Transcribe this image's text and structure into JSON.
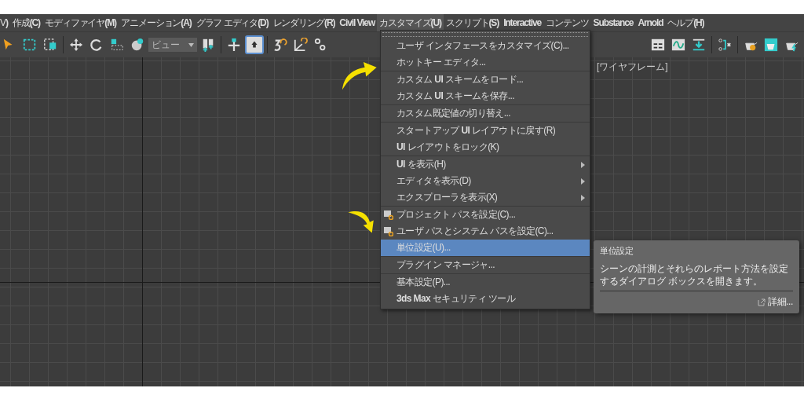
{
  "menubar": [
    {
      "label": "V**)**",
      "selected": false,
      "bold": false
    },
    {
      "label": "作成**(C)**",
      "selected": false,
      "bold": false
    },
    {
      "label": "モディファイヤ**(M)**",
      "selected": false,
      "bold": false
    },
    {
      "label": "アニメーション**(A)**",
      "selected": false,
      "bold": false
    },
    {
      "label": "グラフ エディタ**(D)**",
      "selected": false,
      "bold": false
    },
    {
      "label": "レンダリング**(R)**",
      "selected": false,
      "bold": false
    },
    {
      "label": "Civil View",
      "selected": false,
      "bold": true
    },
    {
      "label": "カスタマイズ**(U)**",
      "selected": true,
      "bold": false
    },
    {
      "label": "スクリプト**(S)**",
      "selected": false,
      "bold": false
    },
    {
      "label": "Interactive",
      "selected": false,
      "bold": true
    },
    {
      "label": "コンテンツ",
      "selected": false,
      "bold": false
    },
    {
      "label": "Substance",
      "selected": false,
      "bold": true
    },
    {
      "label": "Arnold",
      "selected": false,
      "bold": true
    },
    {
      "label": "ヘルプ**(H)**",
      "selected": false,
      "bold": false
    }
  ],
  "toolbar": {
    "left": [
      [
        {
          "kind": "cursor",
          "selected": false
        },
        {
          "kind": "dashed",
          "selected": false
        },
        {
          "kind": "dashedfill",
          "selected": false
        }
      ],
      [
        {
          "kind": "move",
          "selected": false
        },
        {
          "kind": "rotate",
          "selected": false
        },
        {
          "kind": "scale",
          "selected": false
        },
        {
          "kind": "sphere",
          "selected": false
        }
      ]
    ],
    "dropdown": "ビュー",
    "middle": [
      [
        {
          "kind": "bars",
          "selected": false
        }
      ],
      [
        {
          "kind": "pivot",
          "selected": false
        },
        {
          "kind": "box",
          "selected": true
        }
      ],
      [
        {
          "kind": "snap",
          "selected": false
        },
        {
          "kind": "angle",
          "selected": false
        },
        {
          "kind": "percent",
          "selected": false
        }
      ]
    ],
    "right": [
      [
        {
          "kind": "layout",
          "selected": false
        },
        {
          "kind": "curve",
          "selected": false
        },
        {
          "kind": "download",
          "selected": false
        }
      ],
      [
        {
          "kind": "schematic",
          "selected": false
        }
      ],
      [
        {
          "kind": "teapotgear",
          "selected": false
        },
        {
          "kind": "teapotwindow",
          "selected": false
        },
        {
          "kind": "teapotbolt",
          "selected": false
        }
      ]
    ]
  },
  "viewport": {
    "label": "[ワイヤフレーム]"
  },
  "menu": [
    [
      {
        "label": "ユーザ インタフェースをカスタマイズ(C)...",
        "submenu": false,
        "icon": false,
        "selected": false
      },
      {
        "label": "ホットキー エディタ...",
        "submenu": false,
        "icon": false,
        "selected": false
      }
    ],
    [
      {
        "label": "カスタム **UI** スキームをロード...",
        "submenu": false,
        "icon": false,
        "selected": false
      },
      {
        "label": "カスタム **UI** スキームを保存...",
        "submenu": false,
        "icon": false,
        "selected": false
      }
    ],
    [
      {
        "label": "カスタム既定値の切り替え...",
        "submenu": false,
        "icon": false,
        "selected": false
      }
    ],
    [
      {
        "label": "スタートアップ **UI** レイアウトに戻す(R)",
        "submenu": false,
        "icon": false,
        "selected": false
      },
      {
        "label": "**UI** レイアウトをロック(K)",
        "submenu": false,
        "icon": false,
        "selected": false
      }
    ],
    [
      {
        "label": "**UI** を表示(H)",
        "submenu": true,
        "icon": false,
        "selected": false
      },
      {
        "label": "エディタを表示(D)",
        "submenu": true,
        "icon": false,
        "selected": false
      },
      {
        "label": "エクスプローラを表示(X)",
        "submenu": true,
        "icon": false,
        "selected": false
      }
    ],
    [
      {
        "label": "プロジェクト パスを設定(C)...",
        "submenu": false,
        "icon": true,
        "selected": false
      },
      {
        "label": "ユーザ パスとシステム パスを設定(C)...",
        "submenu": false,
        "icon": true,
        "selected": false
      },
      {
        "label": "単位設定(U)...",
        "submenu": false,
        "icon": false,
        "selected": true
      }
    ],
    [
      {
        "label": "プラグイン マネージャ...",
        "submenu": false,
        "icon": false,
        "selected": false
      }
    ],
    [
      {
        "label": "基本設定(P)...",
        "submenu": false,
        "icon": false,
        "selected": false
      },
      {
        "label": "**3ds Max** セキュリティ ツール",
        "submenu": false,
        "icon": false,
        "selected": false
      }
    ]
  ],
  "tooltip": {
    "title": "単位設定",
    "body": "シーンの計測とそれらのレポート方法を設定するダイアログ ボックスを開きます。",
    "link": "詳細..."
  }
}
